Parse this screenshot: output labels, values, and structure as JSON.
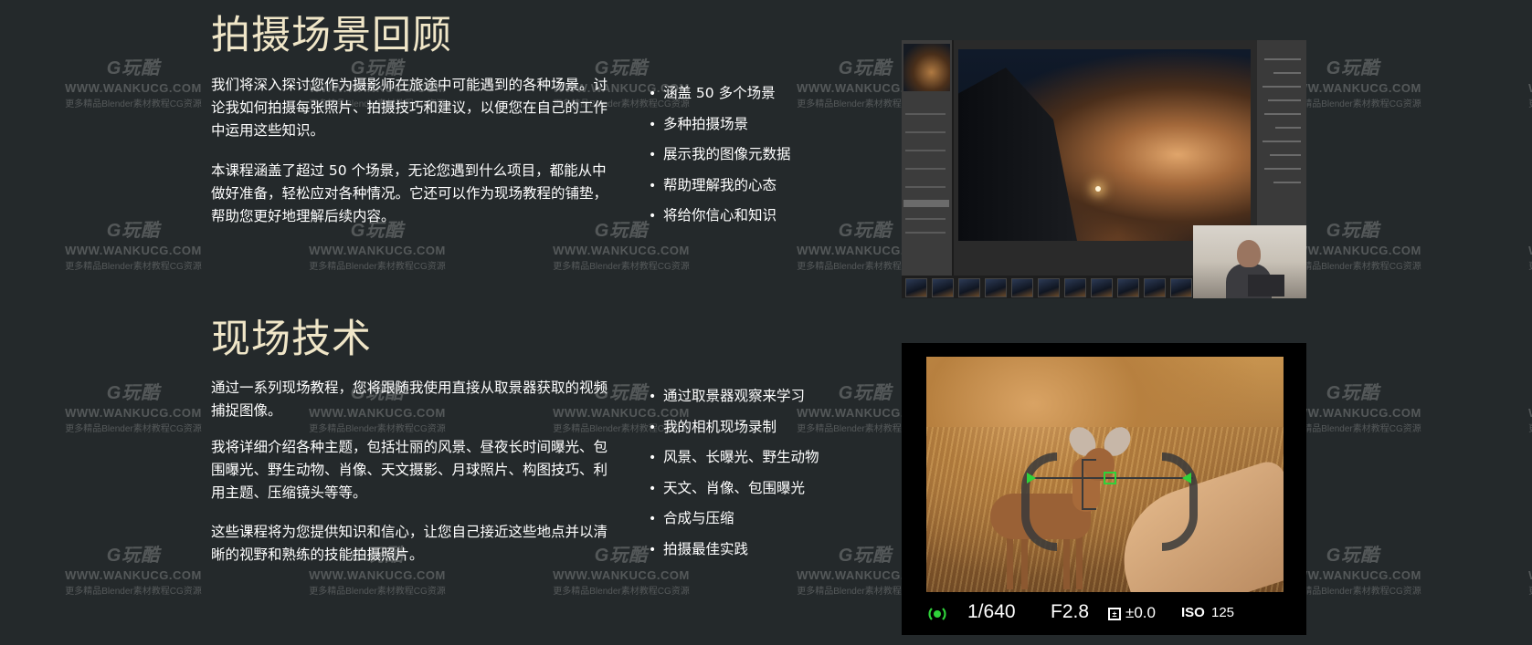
{
  "watermark": {
    "logo": "G玩酷",
    "url": "WWW.WANKUCG.COM",
    "sub": "更多精品Blender素材教程CG资源"
  },
  "section1": {
    "title": "拍摄场景回顾",
    "paragraphs": [
      "我们将深入探讨您作为摄影师在旅途中可能遇到的各种场景。讨论我如何拍摄每张照片、拍摄技巧和建议，以便您在自己的工作中运用这些知识。",
      "本课程涵盖了超过 50 个场景，无论您遇到什么项目，都能从中做好准备，轻松应对各种情况。它还可以作为现场教程的铺垫，帮助您更好地理解后续内容。"
    ],
    "bullets": [
      "涵盖 50 多个场景",
      "多种拍摄场景",
      "展示我的图像元数据",
      "帮助理解我的心态",
      "将给你信心和知识"
    ]
  },
  "section2": {
    "title": "现场技术",
    "paragraphs": [
      "通过一系列现场教程，您将跟随我使用直接从取景器获取的视频捕捉图像。",
      "我将详细介绍各种主题，包括壮丽的风景、昼夜长时间曝光、包围曝光、野生动物、肖像、天文摄影、月球照片、构图技巧、利用主题、压缩镜头等等。",
      "这些课程将为您提供知识和信心，让您自己接近这些地点并以清晰的视野和熟练的技能拍摄照片。"
    ],
    "bullets": [
      "通过取景器观察来学习",
      "我的相机现场录制",
      "风景、长曝光、野生动物",
      "天文、肖像、包围曝光",
      "合成与压缩",
      "拍摄最佳实践"
    ]
  },
  "viewfinder": {
    "shutter": "1/640",
    "aperture": "F2.8",
    "exposure_comp": "±0.0",
    "iso_label": "ISO",
    "iso_value": "125",
    "af_color": "#2fd23a"
  },
  "colors": {
    "background": "#24292b",
    "title": "#f0e6c8"
  }
}
